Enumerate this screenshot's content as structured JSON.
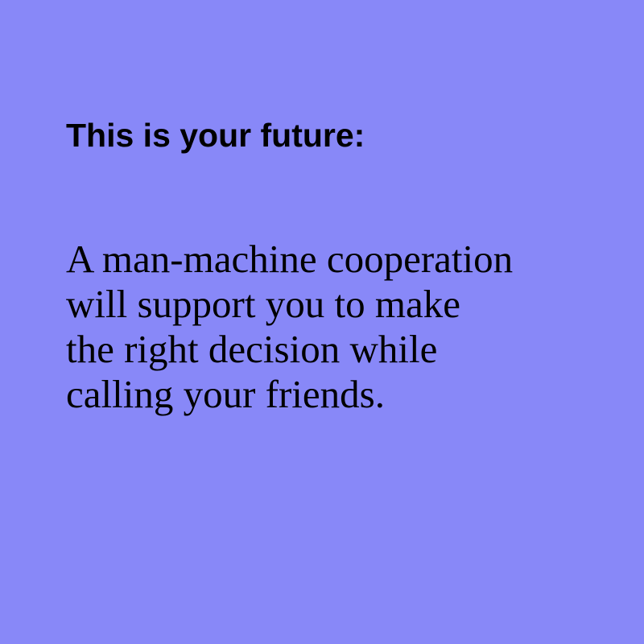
{
  "colors": {
    "background": "#8888f8",
    "text": "#000000"
  },
  "slide": {
    "heading": "This is your future:",
    "body_lines": [
      "A man-machine cooperation",
      "will support you to make",
      "the right decision while",
      "calling your friends."
    ]
  }
}
